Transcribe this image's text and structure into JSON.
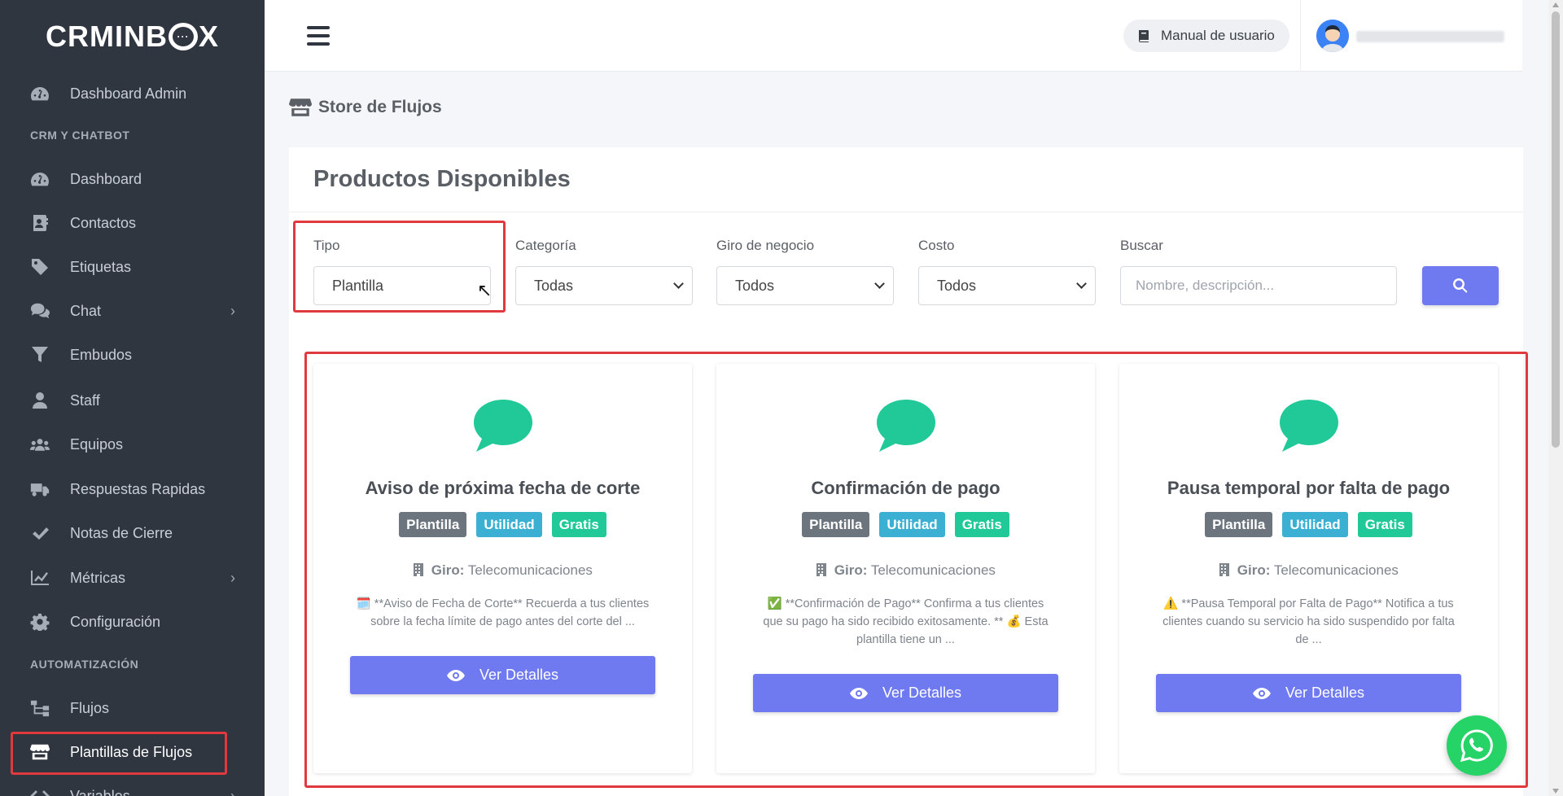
{
  "brand": {
    "name": "CRMINBOX"
  },
  "header": {
    "manual_label": "Manual de usuario"
  },
  "sidebar": {
    "items": [
      {
        "label": "Dashboard Admin",
        "icon": "gauge-icon"
      },
      {
        "label": "Dashboard",
        "icon": "gauge-icon"
      },
      {
        "label": "Contactos",
        "icon": "address-book-icon"
      },
      {
        "label": "Etiquetas",
        "icon": "tag-icon"
      },
      {
        "label": "Chat",
        "icon": "comments-icon"
      },
      {
        "label": "Embudos",
        "icon": "filter-icon"
      },
      {
        "label": "Staff",
        "icon": "user-icon"
      },
      {
        "label": "Equipos",
        "icon": "users-icon"
      },
      {
        "label": "Respuestas Rapidas",
        "icon": "truck-icon"
      },
      {
        "label": "Notas de Cierre",
        "icon": "check-icon"
      },
      {
        "label": "Métricas",
        "icon": "chart-line-icon"
      },
      {
        "label": "Configuración",
        "icon": "gear-icon"
      },
      {
        "label": "Flujos",
        "icon": "sitemap-icon"
      },
      {
        "label": "Plantillas de Flujos",
        "icon": "store-icon"
      },
      {
        "label": "Variables",
        "icon": "code-icon"
      }
    ],
    "section_crm": "CRM Y CHATBOT",
    "section_auto": "AUTOMATIZACIÓN"
  },
  "page": {
    "title": "Store de Flujos",
    "panel_title": "Productos Disponibles"
  },
  "filters": {
    "tipo": {
      "label": "Tipo",
      "value": "Plantilla"
    },
    "categoria": {
      "label": "Categoría",
      "value": "Todas"
    },
    "giro": {
      "label": "Giro de negocio",
      "value": "Todos"
    },
    "costo": {
      "label": "Costo",
      "value": "Todos"
    },
    "buscar": {
      "label": "Buscar",
      "placeholder": "Nombre, descripción..."
    }
  },
  "cards": [
    {
      "title": "Aviso de próxima fecha de corte",
      "badges": [
        "Plantilla",
        "Utilidad",
        "Gratis"
      ],
      "giro_label": "Giro:",
      "giro_value": "Telecomunicaciones",
      "description": "🗓️ **Aviso de Fecha de Corte** Recuerda a tus clientes sobre la fecha límite de pago antes del corte del ...",
      "button": "Ver Detalles"
    },
    {
      "title": "Confirmación de pago",
      "badges": [
        "Plantilla",
        "Utilidad",
        "Gratis"
      ],
      "giro_label": "Giro:",
      "giro_value": "Telecomunicaciones",
      "description": "✅ **Confirmación de Pago** Confirma a tus clientes que su pago ha sido recibido exitosamente. ** 💰 Esta plantilla tiene un ...",
      "button": "Ver Detalles"
    },
    {
      "title": "Pausa temporal por falta de pago",
      "badges": [
        "Plantilla",
        "Utilidad",
        "Gratis"
      ],
      "giro_label": "Giro:",
      "giro_value": "Telecomunicaciones",
      "description": "⚠️ **Pausa Temporal por Falta de Pago** Notifica a tus clientes cuando su servicio ha sido suspendido por falta de ...",
      "button": "Ver Detalles"
    }
  ],
  "colors": {
    "sidebar_bg": "#2f3640",
    "accent": "#6f79f0",
    "chat_icon": "#20c997",
    "highlight": "#e03a3e",
    "whatsapp": "#25d366"
  }
}
